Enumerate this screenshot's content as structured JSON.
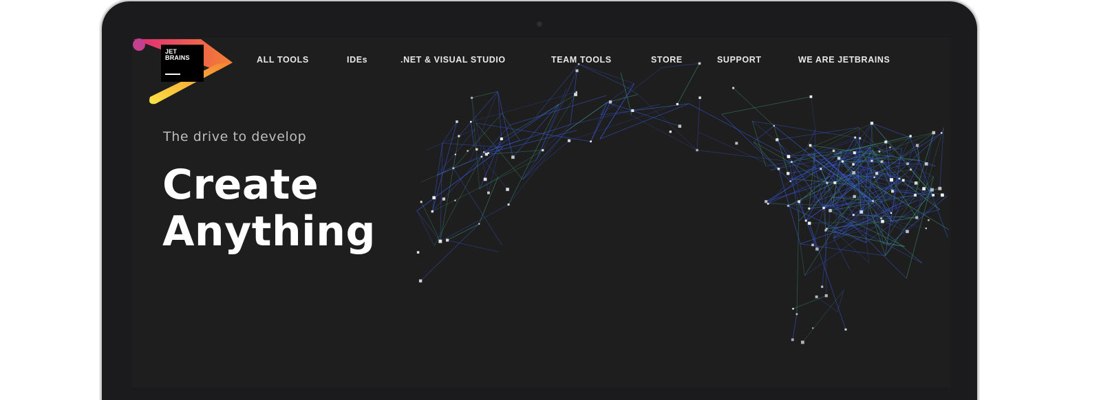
{
  "brand": {
    "logo_line1": "JET",
    "logo_line2": "BRAINS",
    "colors": {
      "pink": "#e0287b",
      "orange": "#f58232",
      "yellow": "#fbe443",
      "dark": "#000000"
    }
  },
  "nav": {
    "items": [
      {
        "label": "ALL TOOLS"
      },
      {
        "label": "IDEs"
      },
      {
        "label": ".NET & VISUAL STUDIO"
      },
      {
        "label": "TEAM TOOLS"
      },
      {
        "label": "STORE"
      },
      {
        "label": "SUPPORT"
      },
      {
        "label": "WE ARE JETBRAINS"
      }
    ]
  },
  "hero": {
    "tagline": "The drive to develop",
    "headline_line1": "Create",
    "headline_line2": "Anything"
  },
  "theme": {
    "background": "#1e1e1e",
    "network_blue": "#3a5be8",
    "network_green": "#3fa07a",
    "node_white": "#ffffff"
  }
}
